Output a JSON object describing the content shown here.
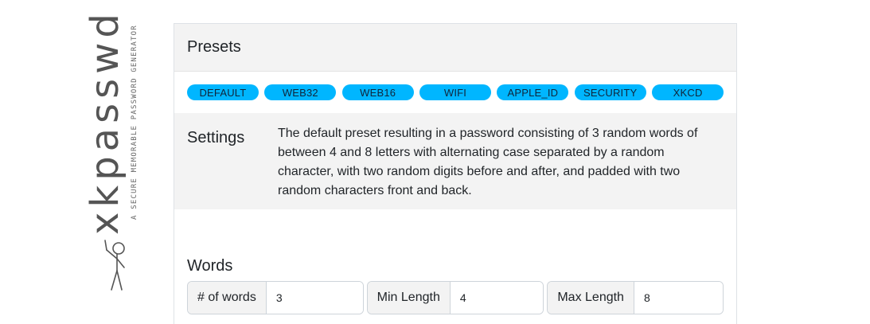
{
  "logo": {
    "word": "xkpasswd",
    "tagline": "A secure memorable password generator"
  },
  "presets": {
    "title": "Presets",
    "buttons": [
      "DEFAULT",
      "WEB32",
      "WEB16",
      "WIFI",
      "APPLE_ID",
      "SECURITY",
      "XKCD"
    ]
  },
  "settings": {
    "title": "Settings",
    "description": "The default preset resulting in a password consisting of 3 random words of between 4 and 8 letters with alternating case separated by a random character, with two random digits before and after, and padded with two random characters front and back."
  },
  "words": {
    "title": "Words",
    "fields": [
      {
        "label": "# of words",
        "value": "3"
      },
      {
        "label": "Min Length",
        "value": "4"
      },
      {
        "label": "Max Length",
        "value": "8"
      }
    ]
  },
  "colors": {
    "preset_button": "#00b6ff",
    "panel_background": "#f3f3f3"
  }
}
